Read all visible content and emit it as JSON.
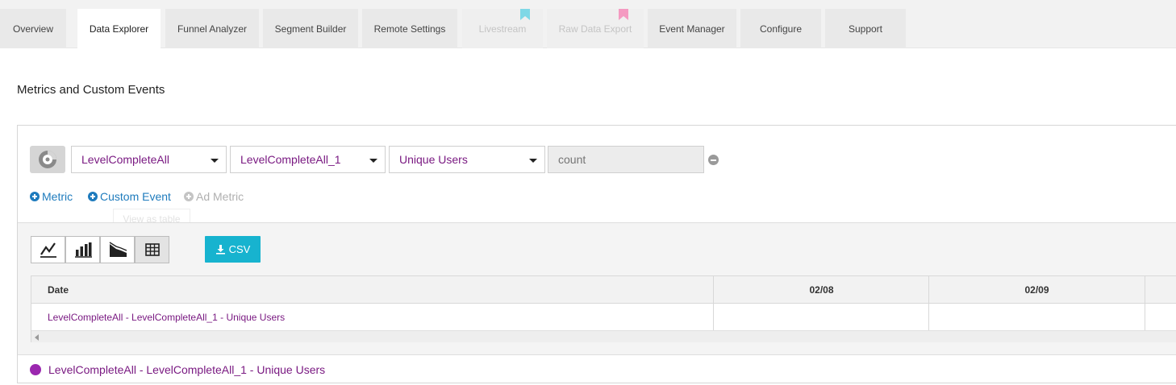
{
  "tabs": [
    {
      "label": "Overview",
      "state": "normal"
    },
    {
      "label": "Data Explorer",
      "state": "active"
    },
    {
      "label": "Funnel Analyzer",
      "state": "normal"
    },
    {
      "label": "Segment Builder",
      "state": "normal"
    },
    {
      "label": "Remote Settings",
      "state": "normal"
    },
    {
      "label": "Livestream",
      "state": "disabled",
      "ribbon": "#7fd8e6"
    },
    {
      "label": "Raw Data Export",
      "state": "disabled",
      "ribbon": "#f49ac1"
    },
    {
      "label": "Event Manager",
      "state": "normal"
    },
    {
      "label": "Configure",
      "state": "normal"
    },
    {
      "label": "Support",
      "state": "normal"
    }
  ],
  "page": {
    "title": "Metrics and Custom Events"
  },
  "metric_row": {
    "icon": "pie-chart-icon",
    "event_select": "LevelCompleteAll",
    "param_select": "LevelCompleteAll_1",
    "measure_select": "Unique Users",
    "count_placeholder": "count"
  },
  "add_links": {
    "metric": "Metric",
    "custom_event": "Custom Event",
    "ad_metric": "Ad Metric"
  },
  "tooltip": "View as table",
  "toolbar": {
    "views": [
      "line-chart-icon",
      "bar-chart-icon",
      "area-chart-icon",
      "table-icon"
    ],
    "active_view": "table-icon",
    "csv_label": "CSV"
  },
  "table": {
    "headers": [
      "Date",
      "02/08",
      "02/09"
    ],
    "rows": [
      {
        "label": "LevelCompleteAll - LevelCompleteAll_1 - Unique Users",
        "values": [
          "",
          ""
        ]
      }
    ]
  },
  "legend": {
    "label": "LevelCompleteAll - LevelCompleteAll_1 - Unique Users",
    "color": "#9b27af"
  },
  "colors": {
    "accent": "#17b3cf",
    "link": "#1e7bbd",
    "value_text": "#7a1a82"
  }
}
